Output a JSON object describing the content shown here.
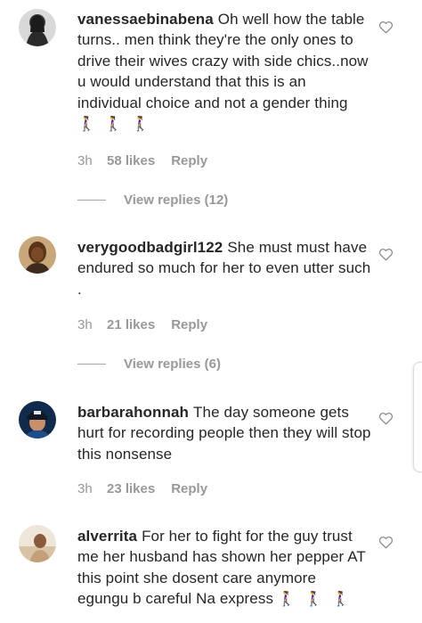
{
  "colors": {
    "text": "#262626",
    "muted": "#999999",
    "background": "#ffffff"
  },
  "comments": [
    {
      "username": "vanessaebinabena",
      "text": "Oh well how the table turns.. men think they're the only ones to drive their wives crazy with side chics..now u would understand that this is an individual choice and not a gender thing",
      "emoji": "🚶‍♀️ 🚶‍♀️ 🚶‍♀️",
      "time": "3h",
      "likes": "58 likes",
      "reply": "Reply",
      "view_replies": "View replies (12)",
      "like_icon": "heart-outline-icon"
    },
    {
      "username": "verygoodbadgirl122",
      "text": "She must must have endured so much for her to even utter such .",
      "time": "3h",
      "likes": "21 likes",
      "reply": "Reply",
      "view_replies": "View replies (6)",
      "like_icon": "heart-outline-icon"
    },
    {
      "username": "barbarahonnah",
      "text": "The day someone gets hurt for recording people then they will stop this nonsense",
      "time": "3h",
      "likes": "23 likes",
      "reply": "Reply",
      "like_icon": "heart-outline-icon"
    },
    {
      "username": "alverrita",
      "text": "For her to fight for the guy trust me her husband has shown her pepper AT this point she dosent care anymore egungu b careful Na express",
      "emoji": "🚶‍♀️ 🚶‍♀️ 🚶‍♀️",
      "like_icon": "heart-outline-icon"
    }
  ]
}
